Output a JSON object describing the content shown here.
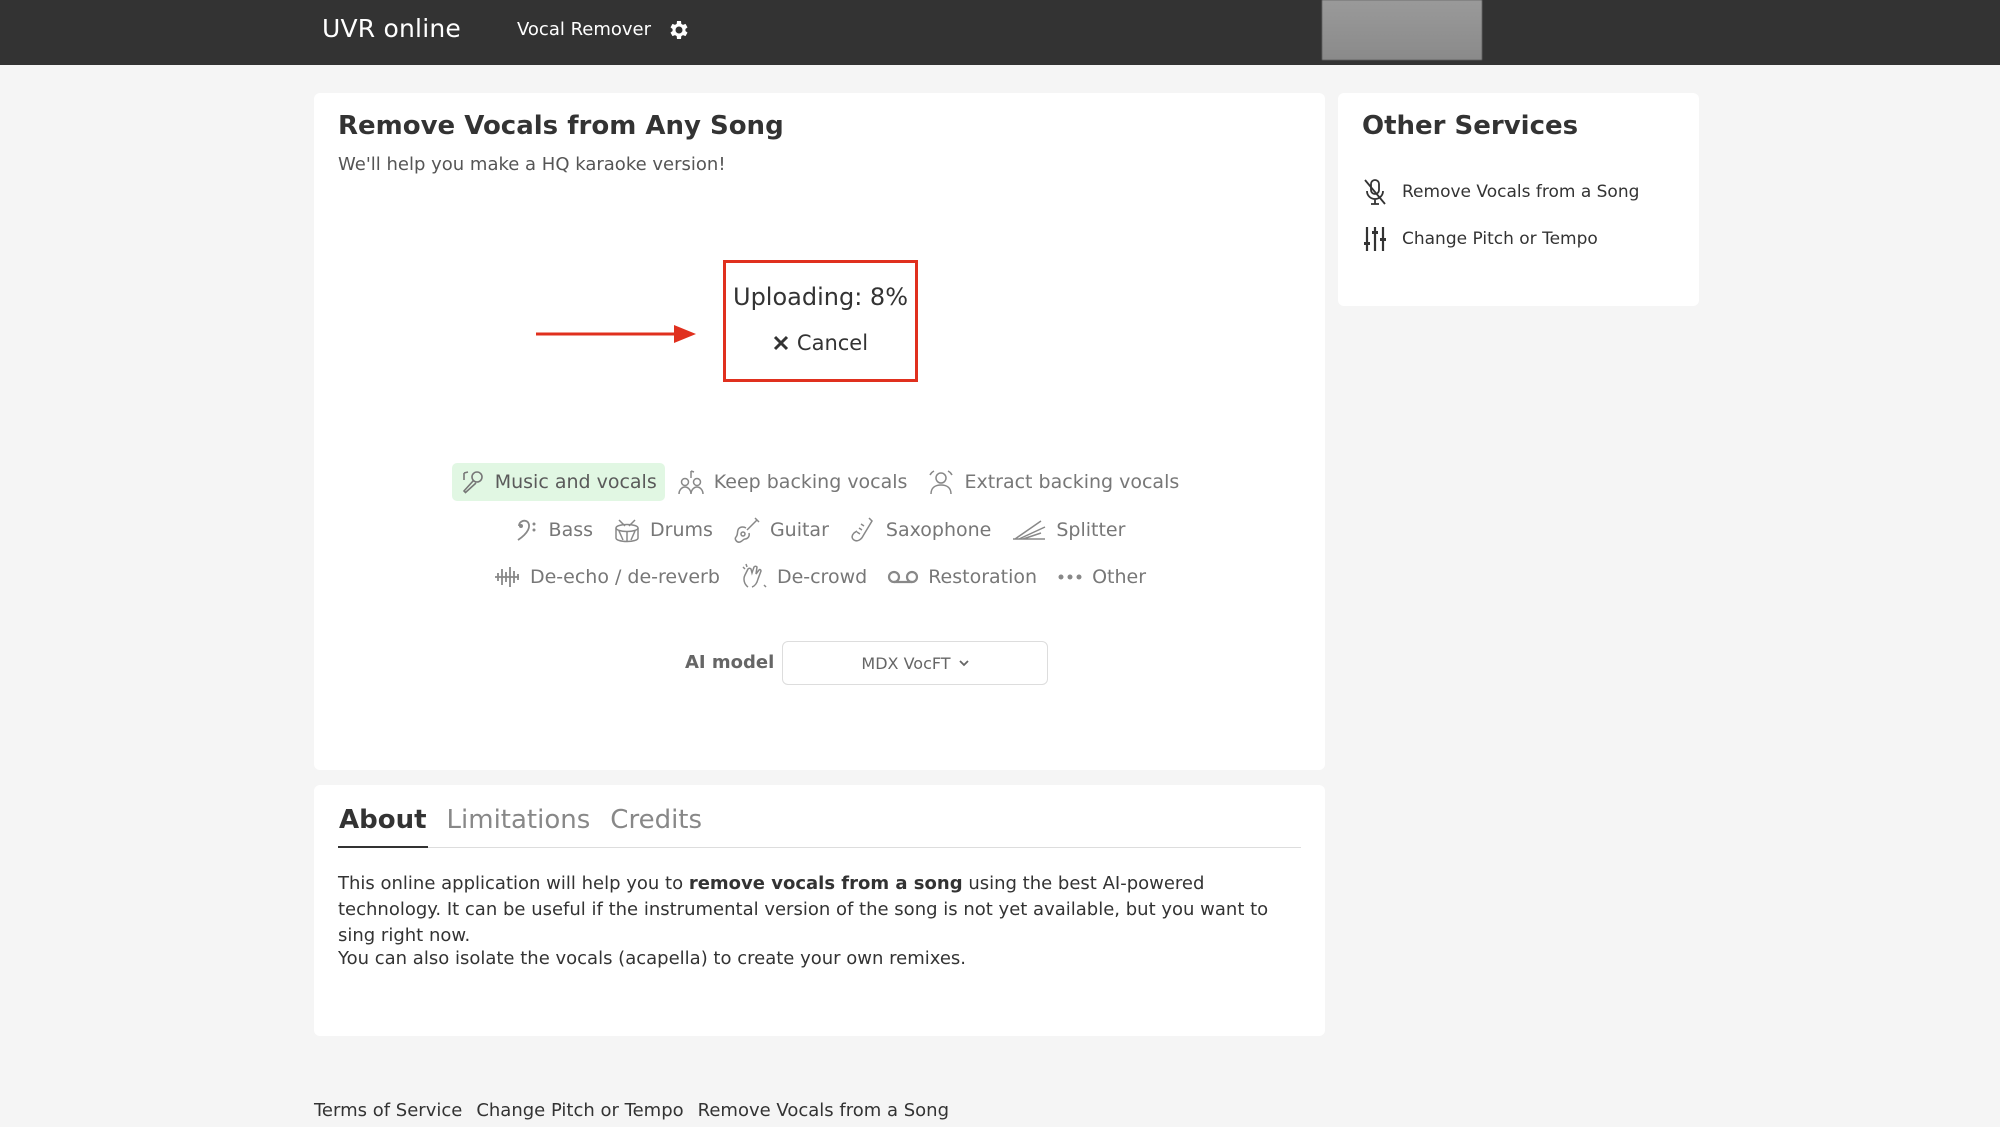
{
  "header": {
    "brand": "UVR online",
    "nav_label": "Vocal Remover",
    "settings_icon": "gear-icon"
  },
  "main": {
    "title": "Remove Vocals from Any Song",
    "subtitle": "We'll help you make a HQ karaoke version!",
    "upload": {
      "status": "Uploading: 8%",
      "progress_percent": 8,
      "cancel_label": "Cancel",
      "highlight_color": "#e0301e"
    },
    "modes": [
      {
        "label": "Music and vocals",
        "icon": "microphone-music-icon",
        "active": true
      },
      {
        "label": "Keep backing vocals",
        "icon": "backing-vocals-icon",
        "active": false
      },
      {
        "label": "Extract backing vocals",
        "icon": "extract-vocals-icon",
        "active": false
      },
      {
        "label": "Bass",
        "icon": "bass-clef-icon",
        "active": false
      },
      {
        "label": "Drums",
        "icon": "drum-icon",
        "active": false
      },
      {
        "label": "Guitar",
        "icon": "guitar-icon",
        "active": false
      },
      {
        "label": "Saxophone",
        "icon": "saxophone-icon",
        "active": false
      },
      {
        "label": "Splitter",
        "icon": "splitter-icon",
        "active": false
      },
      {
        "label": "De-echo / de-reverb",
        "icon": "waveform-icon",
        "active": false
      },
      {
        "label": "De-crowd",
        "icon": "clap-icon",
        "active": false
      },
      {
        "label": "Restoration",
        "icon": "tape-icon",
        "active": false
      },
      {
        "label": "Other",
        "icon": "more-icon",
        "active": false
      }
    ],
    "model": {
      "label": "AI model",
      "value": "MDX VocFT"
    },
    "active_color": "#e1f7e3"
  },
  "side": {
    "title": "Other Services",
    "links": [
      {
        "label": "Remove Vocals from a Song",
        "icon": "mic-off-icon"
      },
      {
        "label": "Change Pitch or Tempo",
        "icon": "sliders-icon"
      }
    ]
  },
  "about": {
    "tabs": [
      "About",
      "Limitations",
      "Credits"
    ],
    "para1_before": "This online application will help you to ",
    "para1_bold": "remove vocals from a song",
    "para1_after": " using the best AI-powered technology. It can be useful if the instrumental version of the song is not yet available, but you want to sing right now.",
    "para2": "You can also isolate the vocals (acapella) to create your own remixes."
  },
  "footer": {
    "links": [
      "Terms of Service",
      "Change Pitch or Tempo",
      "Remove Vocals from a Song"
    ]
  }
}
